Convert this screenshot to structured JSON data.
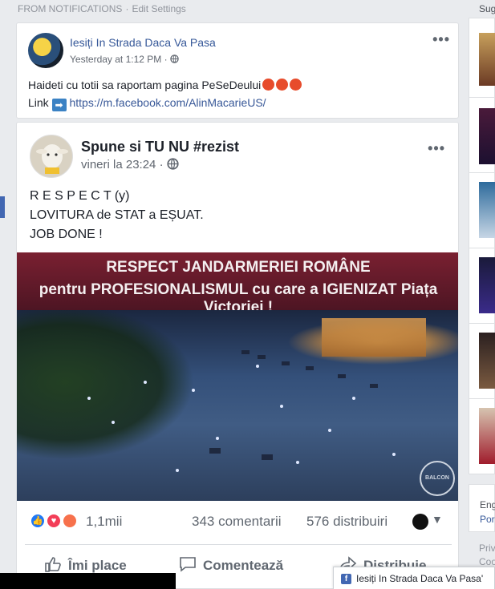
{
  "header": {
    "source": "FROM NOTIFICATIONS",
    "separator": "·",
    "edit_settings": "Edit Settings"
  },
  "post1": {
    "author": "Iesiți In Strada Daca Va Pasa",
    "time": "Yesterday at 1:12 PM",
    "time_sep": "·",
    "line1": "Haideti cu totii sa raportam pagina PeSeDeului",
    "link_label": "Link",
    "link_arrow": "➡",
    "link_url": "https://m.facebook.com/AlinMacarieUS/"
  },
  "post2": {
    "author": "Spune si TU NU #rezist",
    "time": "vineri la 23:24",
    "time_sep": "·",
    "lines": [
      "R E S P E C T (y)",
      "LOVITURA de STAT a EȘUAT.",
      "JOB DONE !"
    ],
    "image": {
      "banner_line1": "RESPECT JANDARMERIEI ROMÂNE",
      "banner_line2": "pentru PROFESIONALISMUL cu care a IGIENIZAT Piața Victoriei !"
    },
    "reactions_count": "1,1mii",
    "comments": "343 comentarii",
    "shares": "576 distribuiri",
    "actions": {
      "like": "Îmi place",
      "comment": "Comentează",
      "share": "Distribuie"
    }
  },
  "right_column": {
    "suggested": "Sug",
    "lang": "Eng",
    "lang_link": "Por",
    "privacy": "Priv",
    "cookies": "Coo"
  },
  "chat_tab": {
    "icon": "f",
    "title": "Iesiți In Strada Daca Va Pasa'"
  },
  "colors": {
    "link": "#365899",
    "background": "#e9ebee",
    "like": "#2078f4",
    "love": "#f33e58",
    "angry": "#f7714c"
  }
}
